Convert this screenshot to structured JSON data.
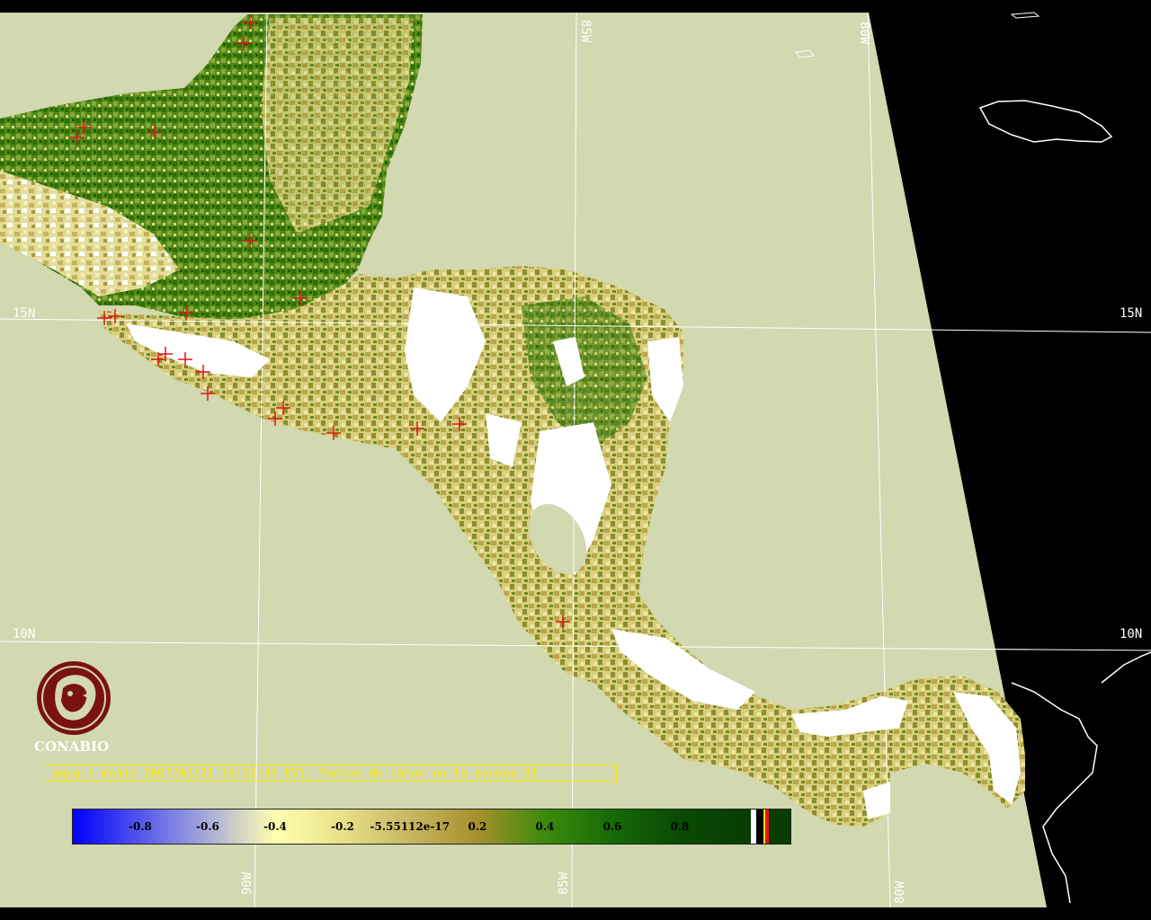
{
  "map": {
    "grid_labels": {
      "lat_15_left": "15N",
      "lat_15_right": "15N",
      "lat_10_left": "10N",
      "lat_10_right": "10N",
      "lon_85_top": "85W",
      "lon_80_top": "80W",
      "lon_90_bottom": "90W",
      "lon_85_bottom": "85W",
      "lon_80_bottom": "80W"
    },
    "colors": {
      "ocean": "#d2d8b0",
      "outside_swath": "#000000",
      "grid": "#ffffff",
      "hotspot": "#e0141a",
      "cloud": "#ffffff"
    }
  },
  "logo": {
    "name": "CONABIO",
    "color": "#7a1212"
  },
  "caption": {
    "text": "aqua-1 modis 2007/01/21 19:23:33 EVI, Puntos de calor en la escena 31"
  },
  "legend": {
    "ticks": [
      "-0.8",
      "-0.6",
      "-0.4",
      "-0.2",
      "-5.55112e-17",
      "0.2",
      "0.4",
      "0.6",
      "0.8"
    ],
    "gradient_stops": [
      {
        "value": -1.0,
        "color": "#0000ff"
      },
      {
        "value": -0.6,
        "color": "#a8acd8"
      },
      {
        "value": -0.4,
        "color": "#ffffb0"
      },
      {
        "value": -0.2,
        "color": "#e8e08a"
      },
      {
        "value": 0.0,
        "color": "#c8b660"
      },
      {
        "value": 0.2,
        "color": "#a6902c"
      },
      {
        "value": 0.4,
        "color": "#3d8a0c"
      },
      {
        "value": 0.6,
        "color": "#166a06"
      },
      {
        "value": 0.8,
        "color": "#0a4a04"
      },
      {
        "value": 1.0,
        "color": "#073d03"
      }
    ],
    "extra_swatches": [
      "#ffffff",
      "#000000",
      "#ffd800",
      "#e0141a"
    ]
  }
}
